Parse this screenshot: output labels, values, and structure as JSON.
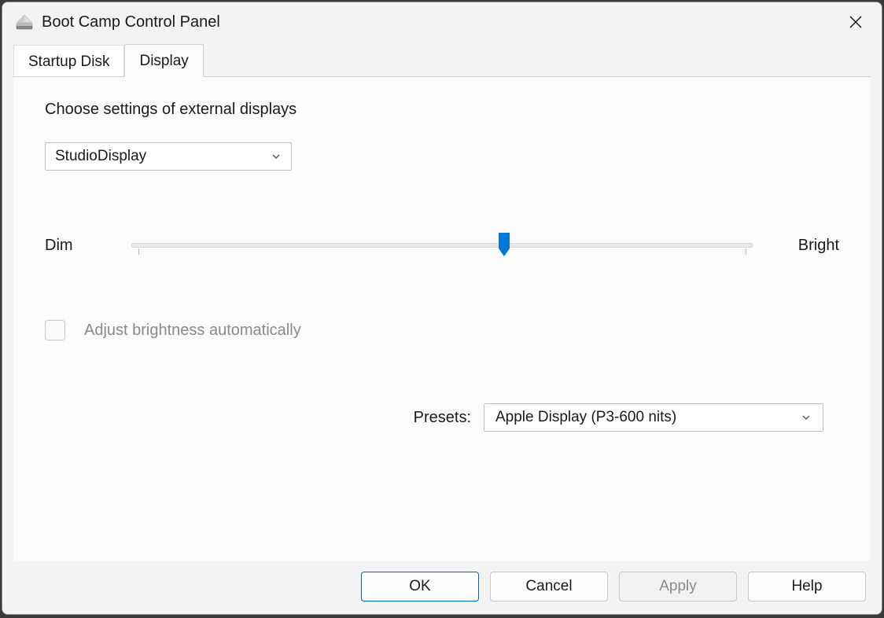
{
  "window": {
    "title": "Boot Camp Control Panel"
  },
  "tabs": [
    {
      "label": "Startup Disk"
    },
    {
      "label": "Display"
    }
  ],
  "display": {
    "heading": "Choose settings of external displays",
    "device_dropdown": {
      "selected": "StudioDisplay"
    },
    "slider": {
      "left_label": "Dim",
      "right_label": "Bright",
      "value_percent": 60
    },
    "auto_brightness": {
      "label": "Adjust brightness automatically",
      "checked": false,
      "enabled": false
    },
    "presets": {
      "label": "Presets:",
      "selected": "Apple Display (P3-600 nits)"
    }
  },
  "buttons": {
    "ok": "OK",
    "cancel": "Cancel",
    "apply": "Apply",
    "help": "Help"
  }
}
